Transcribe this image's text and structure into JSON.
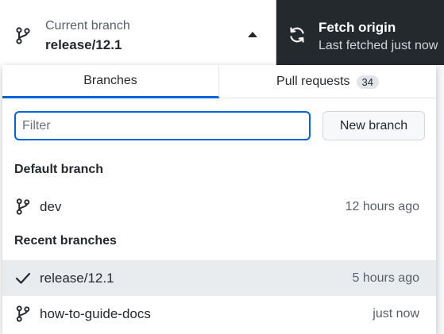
{
  "toolbar": {
    "current_branch_caption": "Current branch",
    "current_branch_value": "release/12.1",
    "fetch_caption": "Fetch origin",
    "fetch_status": "Last fetched just now"
  },
  "tabs": {
    "branches_label": "Branches",
    "pull_requests_label": "Pull requests",
    "pull_requests_count": "34"
  },
  "filter": {
    "placeholder": "Filter",
    "value": ""
  },
  "new_branch_label": "New branch",
  "default_group": {
    "header": "Default branch",
    "items": [
      {
        "name": "dev",
        "time": "12 hours ago",
        "icon": "git-branch-icon"
      }
    ]
  },
  "recent_group": {
    "header": "Recent branches",
    "items": [
      {
        "name": "release/12.1",
        "time": "5 hours ago",
        "icon": "check-icon",
        "selected": true
      },
      {
        "name": "how-to-guide-docs",
        "time": "just now",
        "icon": "git-branch-icon"
      }
    ]
  },
  "colors": {
    "accent": "#0366d6",
    "toolbar_dark": "#24292e",
    "selected_row": "#e9ecef"
  }
}
